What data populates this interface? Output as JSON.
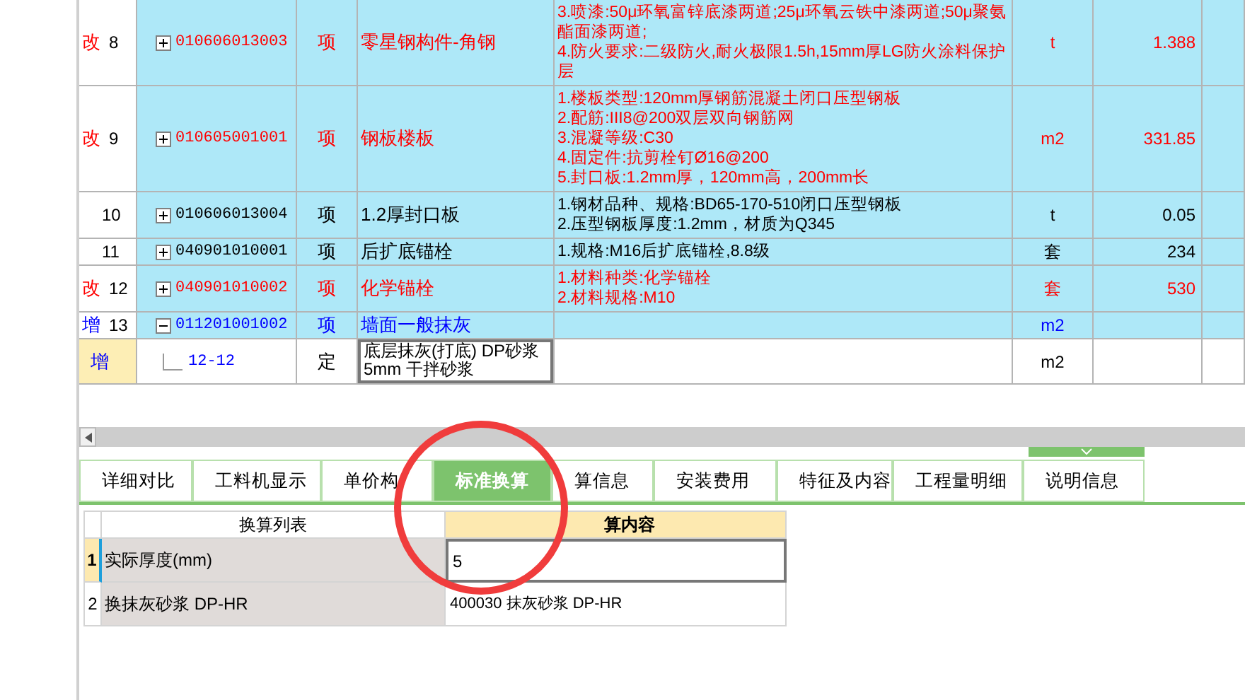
{
  "rows": [
    {
      "color": "#ff0000",
      "mark": "改",
      "number": "8",
      "expanded": false,
      "code": "010606013003",
      "type": "项",
      "name": "零星钢构件-角钢",
      "spec": [
        "3.喷漆:50μ环氧富锌底漆两道;25μ环氧云铁中漆两道;50μ聚氨酯面漆两道;",
        "4.防火要求:二级防火,耐火极限1.5h,15mm厚LG防火涂料保护层"
      ],
      "unit": "t",
      "quantity": "1.388"
    },
    {
      "color": "#ff0000",
      "mark": "改",
      "number": "9",
      "expanded": false,
      "code": "010605001001",
      "type": "项",
      "name": "钢板楼板",
      "spec": [
        "1.楼板类型:120mm厚钢筋混凝土闭口压型钢板",
        "2.配筋:III8@200双层双向钢筋网",
        "3.混凝等级:C30",
        "4.固定件:抗剪栓钉Ø16@200",
        "5.封口板:1.2mm厚，120mm高，200mm长"
      ],
      "unit": "m2",
      "quantity": "331.85"
    },
    {
      "color": "#000000",
      "number": "10",
      "expanded": false,
      "code": "010606013004",
      "type": "项",
      "name": "1.2厚封口板",
      "spec": [
        "1.钢材品种、规格:BD65-170-510闭口压型钢板",
        "2.压型钢板厚度:1.2mm，材质为Q345"
      ],
      "unit": "t",
      "quantity": "0.05"
    },
    {
      "color": "#000000",
      "number": "11",
      "expanded": false,
      "code": "040901010001",
      "type": "项",
      "name": "后扩底锚栓",
      "spec": [
        "1.规格:M16后扩底锚栓,8.8级"
      ],
      "unit": "套",
      "quantity": "234"
    },
    {
      "color": "#ff0000",
      "mark": "改",
      "number": "12",
      "expanded": false,
      "code": "040901010002",
      "type": "项",
      "name": "化学锚栓",
      "spec": [
        "1.材料种类:化学锚栓",
        "2.材料规格:M10"
      ],
      "unit": "套",
      "quantity": "530"
    },
    {
      "color": "#0000ff",
      "mark": "增",
      "number": "13",
      "expanded": true,
      "code": "011201001002",
      "type": "项",
      "name": "墙面一般抹灰",
      "unit": "m2"
    }
  ],
  "sub_row": {
    "mark": "增",
    "code": "12-12",
    "type": "定",
    "name": "底层抹灰(打底) DP砂浆 5mm 干拌砂浆",
    "unit": "m2"
  },
  "tabs": [
    {
      "label": "详细对比",
      "selected": false
    },
    {
      "label": "工料机显示",
      "selected": false
    },
    {
      "label": "单价构",
      "selected": false
    },
    {
      "label": "标准换算",
      "selected": true
    },
    {
      "label": "算信息",
      "selected": false
    },
    {
      "label": "安装费用",
      "selected": false
    },
    {
      "label": "特征及内容",
      "selected": false
    },
    {
      "label": "工程量明细",
      "selected": false
    },
    {
      "label": "说明信息",
      "selected": false
    }
  ],
  "grid": {
    "columns": [
      "换算列表",
      "算内容"
    ],
    "rows": [
      {
        "index": "1",
        "label": "实际厚度(mm)",
        "value": "5",
        "selected": true
      },
      {
        "index": "2",
        "label": "换抹灰砂浆 DP-HR",
        "value": "400030   抹灰砂浆 DP-HR",
        "selected": false
      }
    ]
  }
}
